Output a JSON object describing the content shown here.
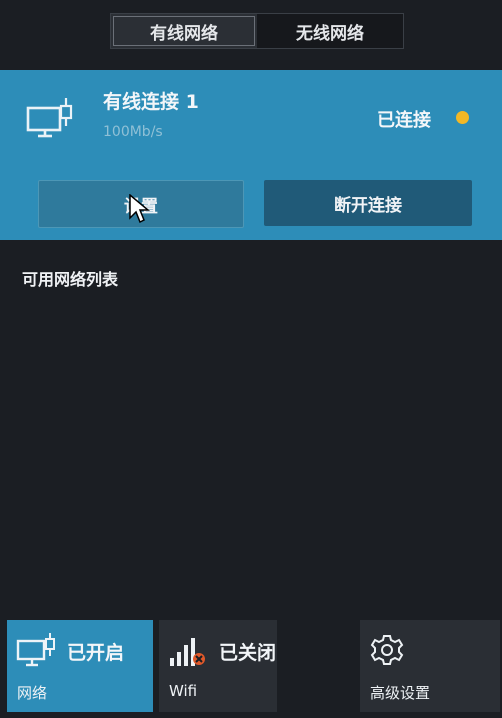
{
  "tabs": [
    "有线网络",
    "无线网络"
  ],
  "active_tab": 0,
  "connection": {
    "name": "有线连接 1",
    "speed": "100Mb/s",
    "status": "已连接",
    "status_color": "#f2b826",
    "icon": "ethernet-monitor-icon"
  },
  "buttons": {
    "settings": "设置",
    "disconnect": "断开连接"
  },
  "list": {
    "title": "可用网络列表",
    "items": []
  },
  "tiles": {
    "network": {
      "state": "已开启",
      "label": "网络",
      "icon": "ethernet-monitor-icon"
    },
    "wifi": {
      "state": "已关闭",
      "label": "Wifi",
      "icon": "wifi-signal-off-icon"
    },
    "advanced": {
      "label": "高级设置",
      "icon": "gear-icon"
    }
  },
  "colors": {
    "accent": "#2d8db8",
    "background": "#1b1e23",
    "tile_inactive": "#2a2e34"
  }
}
